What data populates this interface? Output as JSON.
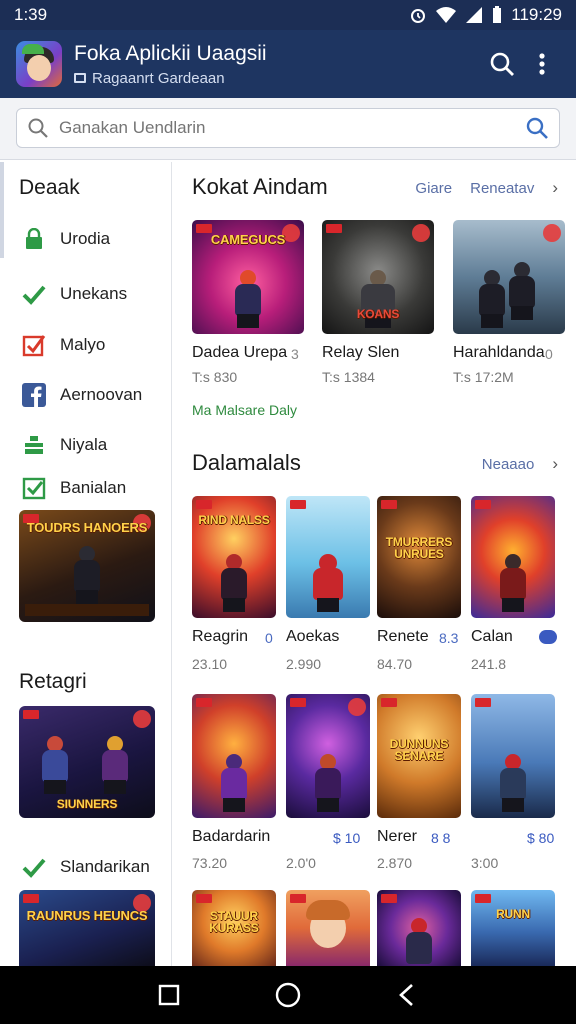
{
  "status_bar": {
    "time_left": "1:39",
    "time_right": "119:29"
  },
  "app": {
    "title": "Foka Aplickii Uaagsii",
    "subtitle": "Ragaanrt Gardeaan"
  },
  "search": {
    "placeholder": "Ganakan Uendlarin"
  },
  "sidebar": {
    "heading": "Deaak",
    "items": [
      {
        "label": "Urodia",
        "icon": "lock-icon",
        "color": "#2e9a46"
      },
      {
        "label": "Unekans",
        "icon": "check-icon",
        "color": "#2e9a46"
      },
      {
        "label": "Malyo",
        "icon": "checkbox-red-icon",
        "color": "#d93a2b"
      },
      {
        "label": "Aernoovan",
        "icon": "facebook-icon",
        "color": "#3b5998"
      },
      {
        "label": "Niyala",
        "icon": "stack-icon",
        "color": "#2e9a46"
      },
      {
        "label": "Banialan",
        "icon": "checkbox-green-icon",
        "color": "#2e9a46"
      }
    ],
    "heading2": "Retagri",
    "item_bottom": {
      "label": "Slandarikan",
      "icon": "check-icon"
    },
    "thumb1_title": "TOUDRS HANOERS",
    "thumb2_title": "SIUNNERS",
    "thumb3_title": "RAUNRUS HEUNCS"
  },
  "section1": {
    "title": "Kokat Aindam",
    "link1": "Giare",
    "link2": "Reneatav",
    "cards": [
      {
        "name": "Dadea Urepa",
        "extra": "3",
        "meta": "T:s 830",
        "art_title": "CAMEGUCS"
      },
      {
        "name": "Relay Slen",
        "extra": "",
        "meta": "T:s 1384",
        "art_title": "KOANS"
      },
      {
        "name": "Harahldanda",
        "extra": "0",
        "meta": "T:s 17:2M",
        "art_title": ""
      }
    ],
    "note": "Ma Malsare Daly"
  },
  "section2": {
    "title": "Dalamalals",
    "link": "Neaaao",
    "row1": [
      {
        "name": "Reagrin",
        "extra": "0",
        "meta": "23.10",
        "art_title": "RIND NALSS"
      },
      {
        "name": "Aoekas",
        "extra": "",
        "meta": "2.990",
        "art_title": ""
      },
      {
        "name": "Renete",
        "extra": "8.3",
        "meta": "84.70",
        "art_title": "TMURRERS UNRUES"
      },
      {
        "name": "Calan",
        "extra": "",
        "meta": "241.8",
        "art_title": ""
      }
    ],
    "row2": [
      {
        "name": "Badardarin",
        "extra": "$ 10",
        "meta": "73.20",
        "art_title": ""
      },
      {
        "name": "",
        "extra": "",
        "meta": "2.0'0",
        "art_title": ""
      },
      {
        "name": "Nerer",
        "extra": "8 8",
        "meta": "2.870",
        "art_title": "DUNNUNS SENARE"
      },
      {
        "name": "",
        "extra": "$ 80",
        "meta": "3:00",
        "art_title": ""
      }
    ],
    "row3_titles": [
      "STAUUR KURASS",
      "",
      "",
      "RUNN"
    ]
  },
  "colors": {
    "appbar": "#1e3561",
    "link": "#5a6fa6",
    "accent_green": "#2e8a3e"
  }
}
